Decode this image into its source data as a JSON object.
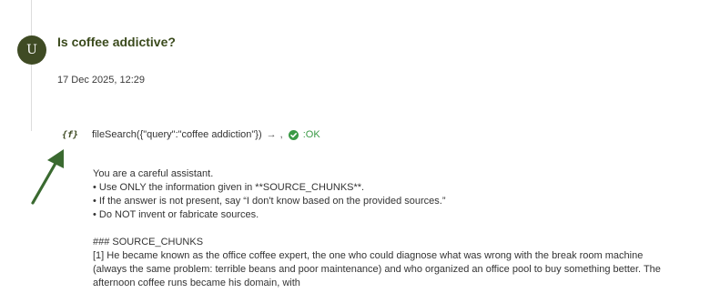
{
  "message": {
    "avatar_initial": "U",
    "question": "Is coffee addictive?",
    "timestamp": "17 Dec 2025, 12:29"
  },
  "tool_call": {
    "icon_label": "{f}",
    "call_text": "fileSearch({\"query\":\"coffee addiction\"})",
    "arrow": "→",
    "separator": ",",
    "status_label": ":OK",
    "status_color": "#3a9a46"
  },
  "prompt": {
    "intro": "You are a careful assistant.",
    "rules": [
      "• Use ONLY the information given in **SOURCE_CHUNKS**.",
      "• If the answer is not present, say “I don't know based on the provided sources.”",
      "• Do NOT invent or fabricate sources."
    ],
    "chunks_heading": "### SOURCE_CHUNKS",
    "chunk_1": "[1] He became known as the office coffee expert, the one who could diagnose what was wrong with the break room machine (always the same problem: terrible beans and poor maintenance) and who organized an office pool to buy something better. The afternoon coffee runs became his domain, with"
  },
  "colors": {
    "accent": "#3f4b24",
    "title": "#3a4a1c",
    "annotation_arrow": "#3a6a30"
  }
}
